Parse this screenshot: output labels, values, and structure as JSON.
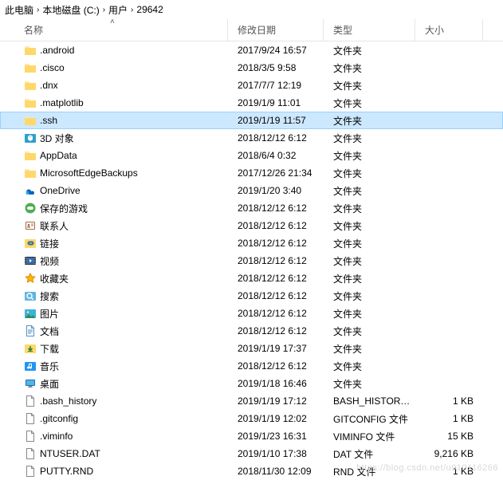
{
  "breadcrumb": [
    {
      "label": "此电脑"
    },
    {
      "label": "本地磁盘 (C:)"
    },
    {
      "label": "用户"
    },
    {
      "label": "29642"
    }
  ],
  "columns": {
    "name": "名称",
    "date": "修改日期",
    "type": "类型",
    "size": "大小"
  },
  "rows": [
    {
      "icon": "folder",
      "name": ".android",
      "date": "2017/9/24 16:57",
      "type": "文件夹",
      "size": "",
      "selected": false
    },
    {
      "icon": "folder",
      "name": ".cisco",
      "date": "2018/3/5 9:58",
      "type": "文件夹",
      "size": "",
      "selected": false
    },
    {
      "icon": "folder",
      "name": ".dnx",
      "date": "2017/7/7 12:19",
      "type": "文件夹",
      "size": "",
      "selected": false
    },
    {
      "icon": "folder",
      "name": ".matplotlib",
      "date": "2019/1/9 11:01",
      "type": "文件夹",
      "size": "",
      "selected": false
    },
    {
      "icon": "folder",
      "name": ".ssh",
      "date": "2019/1/19 11:57",
      "type": "文件夹",
      "size": "",
      "selected": true
    },
    {
      "icon": "3dobjects",
      "name": "3D 对象",
      "date": "2018/12/12 6:12",
      "type": "文件夹",
      "size": "",
      "selected": false
    },
    {
      "icon": "folder",
      "name": "AppData",
      "date": "2018/6/4 0:32",
      "type": "文件夹",
      "size": "",
      "selected": false
    },
    {
      "icon": "folder",
      "name": "MicrosoftEdgeBackups",
      "date": "2017/12/26 21:34",
      "type": "文件夹",
      "size": "",
      "selected": false
    },
    {
      "icon": "onedrive",
      "name": "OneDrive",
      "date": "2019/1/20 3:40",
      "type": "文件夹",
      "size": "",
      "selected": false
    },
    {
      "icon": "savedgames",
      "name": "保存的游戏",
      "date": "2018/12/12 6:12",
      "type": "文件夹",
      "size": "",
      "selected": false
    },
    {
      "icon": "contacts",
      "name": "联系人",
      "date": "2018/12/12 6:12",
      "type": "文件夹",
      "size": "",
      "selected": false
    },
    {
      "icon": "links",
      "name": "链接",
      "date": "2018/12/12 6:12",
      "type": "文件夹",
      "size": "",
      "selected": false
    },
    {
      "icon": "videos",
      "name": "视频",
      "date": "2018/12/12 6:12",
      "type": "文件夹",
      "size": "",
      "selected": false
    },
    {
      "icon": "favorites",
      "name": "收藏夹",
      "date": "2018/12/12 6:12",
      "type": "文件夹",
      "size": "",
      "selected": false
    },
    {
      "icon": "searches",
      "name": "搜索",
      "date": "2018/12/12 6:12",
      "type": "文件夹",
      "size": "",
      "selected": false
    },
    {
      "icon": "pictures",
      "name": "图片",
      "date": "2018/12/12 6:12",
      "type": "文件夹",
      "size": "",
      "selected": false
    },
    {
      "icon": "documents",
      "name": "文档",
      "date": "2018/12/12 6:12",
      "type": "文件夹",
      "size": "",
      "selected": false
    },
    {
      "icon": "downloads",
      "name": "下载",
      "date": "2019/1/19 17:37",
      "type": "文件夹",
      "size": "",
      "selected": false
    },
    {
      "icon": "music",
      "name": "音乐",
      "date": "2018/12/12 6:12",
      "type": "文件夹",
      "size": "",
      "selected": false
    },
    {
      "icon": "desktop",
      "name": "桌面",
      "date": "2019/1/18 16:46",
      "type": "文件夹",
      "size": "",
      "selected": false
    },
    {
      "icon": "file",
      "name": ".bash_history",
      "date": "2019/1/19 17:12",
      "type": "BASH_HISTORY ...",
      "size": "1 KB",
      "selected": false
    },
    {
      "icon": "file",
      "name": ".gitconfig",
      "date": "2019/1/19 12:02",
      "type": "GITCONFIG 文件",
      "size": "1 KB",
      "selected": false
    },
    {
      "icon": "file",
      "name": ".viminfo",
      "date": "2019/1/23 16:31",
      "type": "VIMINFO 文件",
      "size": "15 KB",
      "selected": false
    },
    {
      "icon": "file",
      "name": "NTUSER.DAT",
      "date": "2019/1/10 17:38",
      "type": "DAT 文件",
      "size": "9,216 KB",
      "selected": false
    },
    {
      "icon": "file",
      "name": "PUTTY.RND",
      "date": "2018/11/30 12:09",
      "type": "RND 文件",
      "size": "1 KB",
      "selected": false
    }
  ],
  "watermark": "https://blog.csdn.net/u010116266"
}
